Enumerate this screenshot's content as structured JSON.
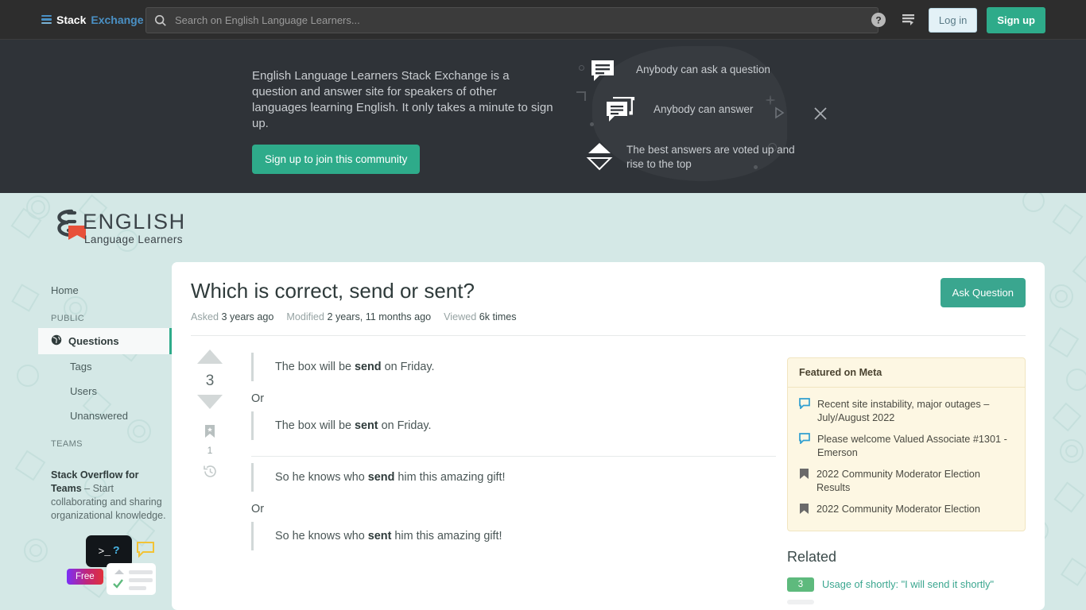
{
  "topbar": {
    "logo_stack": "Stack",
    "logo_exchange": "Exchange",
    "search_placeholder": "Search on English Language Learners...",
    "search_value": "",
    "help_icon": "help-circle-icon",
    "inbox_icon": "inbox-icon",
    "login_label": "Log in",
    "signup_label": "Sign up"
  },
  "hero": {
    "description": "English Language Learners Stack Exchange is a question and answer site for speakers of other languages learning English. It only takes a minute to sign up.",
    "cta_label": "Sign up to join this community",
    "bullets": [
      {
        "icon": "speech-bubble-icon",
        "text": "Anybody can ask a question"
      },
      {
        "icon": "speech-bubbles-icon",
        "text": "Anybody can answer"
      },
      {
        "icon": "vote-arrows-icon",
        "text": "The best answers are voted up and rise to the top"
      }
    ],
    "play_icon": "play-triangle-icon",
    "close_icon": "close-icon"
  },
  "site": {
    "logo_title": "ENGLISH",
    "logo_subtitle": "Language Learners"
  },
  "sidebar": {
    "home_label": "Home",
    "public_header": "PUBLIC",
    "items": [
      {
        "label": "Questions",
        "icon": "globe-icon",
        "selected": true
      },
      {
        "label": "Tags",
        "selected": false
      },
      {
        "label": "Users",
        "selected": false
      },
      {
        "label": "Unanswered",
        "selected": false
      }
    ],
    "teams_header": "TEAMS",
    "teams_promo_bold": "Stack Overflow for Teams",
    "teams_promo_rest": " – Start collaborating and sharing organizational knowledge.",
    "free_badge": "Free",
    "terminal_glyph": ">_",
    "terminal_question": "?"
  },
  "question": {
    "title": "Which is correct, send or sent?",
    "ask_button": "Ask Question",
    "meta": [
      {
        "label": "Asked",
        "value": "3 years ago"
      },
      {
        "label": "Modified",
        "value": "2 years, 11 months ago"
      },
      {
        "label": "Viewed",
        "value": "6k times"
      }
    ],
    "votes": "3",
    "bookmark_count": "1",
    "bookmark_icon": "bookmark-icon",
    "history_icon": "history-icon",
    "upvote_icon": "upvote-arrow-icon",
    "downvote_icon": "downvote-arrow-icon",
    "body": {
      "quote1_pre": "The box will be ",
      "quote1_bold": "send",
      "quote1_post": " on Friday.",
      "or1": "Or",
      "quote2_pre": "The box will be ",
      "quote2_bold": "sent",
      "quote2_post": " on Friday.",
      "quote3_pre": "So he knows who ",
      "quote3_bold": "send",
      "quote3_post": " him this amazing gift!",
      "or2": "Or",
      "quote4_pre": "So he knows who ",
      "quote4_bold": "sent",
      "quote4_post": " him this amazing gift!"
    }
  },
  "featured": {
    "header": "Featured on Meta",
    "items": [
      {
        "icon": "speech-bubble-outline-icon",
        "icon_color": "#2f9fd0",
        "text": "Recent site instability, major outages – July/August 2022"
      },
      {
        "icon": "speech-bubble-outline-icon",
        "icon_color": "#2f9fd0",
        "text": "Please welcome Valued Associate #1301 - Emerson"
      },
      {
        "icon": "bookmark-filled-icon",
        "icon_color": "#6a6a6a",
        "text": "2022 Community Moderator Election Results"
      },
      {
        "icon": "bookmark-filled-icon",
        "icon_color": "#6a6a6a",
        "text": "2022 Community Moderator Election"
      }
    ]
  },
  "related": {
    "header": "Related",
    "items": [
      {
        "score": "3",
        "title": "Usage of shortly: \"I will send it shortly\"",
        "dim": false
      },
      {
        "score": "",
        "title": "",
        "dim": true
      }
    ]
  },
  "colors": {
    "accent_teal": "#2eab8a",
    "page_bg": "#d4e8e6",
    "hero_bg": "#2f3338",
    "topbar_bg": "#2d2d2d",
    "meta_box_bg": "#fdf7e3",
    "related_badge_green": "#5eba7d",
    "link_teal": "#3aa68f"
  }
}
